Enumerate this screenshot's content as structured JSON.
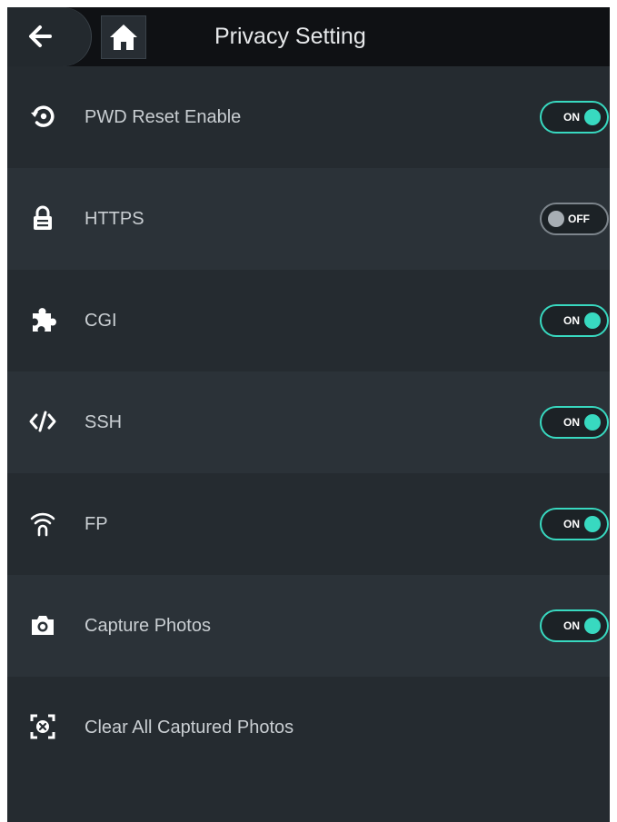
{
  "header": {
    "title": "Privacy Setting",
    "back_icon": "arrow-left-icon",
    "home_icon": "home-icon"
  },
  "colors": {
    "header_bg": "#0f1114",
    "panel_bg": "#252b30",
    "row_alt_bg": "#2b3238",
    "toggle_on": "#38d9c0",
    "toggle_off": "#7d858c",
    "text": "#c9ced2"
  },
  "settings": [
    {
      "label": "PWD Reset Enable",
      "icon": "password-reset-icon",
      "toggle": "ON"
    },
    {
      "label": "HTTPS",
      "icon": "lock-icon",
      "toggle": "OFF"
    },
    {
      "label": "CGI",
      "icon": "puzzle-icon",
      "toggle": "ON"
    },
    {
      "label": "SSH",
      "icon": "code-icon",
      "toggle": "ON"
    },
    {
      "label": "FP",
      "icon": "fingerprint-wifi-icon",
      "toggle": "ON"
    },
    {
      "label": "Capture Photos",
      "icon": "camera-icon",
      "toggle": "ON"
    },
    {
      "label": "Clear All Captured Photos",
      "icon": "clear-photos-icon"
    }
  ]
}
